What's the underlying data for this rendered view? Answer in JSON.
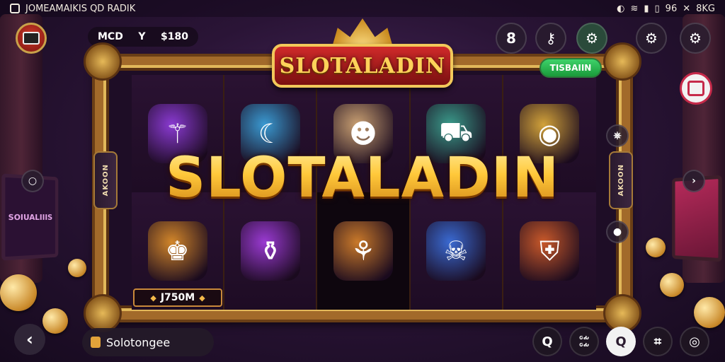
{
  "status_bar": {
    "left_text": "JOMEAMAIKIS QD RADIK",
    "right_text": "96",
    "right_text2": "8KG",
    "icons": [
      "app-icon",
      "circle-icon",
      "wifi-icon",
      "signal-icon",
      "battery-icon",
      "close-x-icon"
    ]
  },
  "top_left": {
    "pill_left": "MCD",
    "pill_mid": "Y",
    "pill_right": "$180"
  },
  "banner": {
    "title": "SLOTALADIN"
  },
  "logo": {
    "text": "SLOTALADIN"
  },
  "side_tabs": {
    "left": "AKOON",
    "right": "AKOON"
  },
  "green_badge": "TISBAIIN",
  "reels": [
    {
      "icon": "staff-orb-icon",
      "glyph": "⚚",
      "color": "#8a3ad2"
    },
    {
      "icon": "wave-icon",
      "glyph": "☾",
      "color": "#3a9ad2"
    },
    {
      "icon": "genie-mask-icon",
      "glyph": "☻",
      "color": "#c9a072"
    },
    {
      "icon": "cart-icon",
      "glyph": "⛟",
      "color": "#3a9a8a"
    },
    {
      "icon": "golden-ring-icon",
      "glyph": "◉",
      "color": "#d2a23a"
    },
    {
      "icon": "golden-idol-icon",
      "glyph": "♚",
      "color": "#d2862a"
    },
    {
      "icon": "purple-lamp-icon",
      "glyph": "⚱",
      "color": "#9a3ad2"
    },
    {
      "icon": "sitar-bowl-icon",
      "glyph": "⚘",
      "color": "#c9792a"
    },
    {
      "icon": "blue-demon-icon",
      "glyph": "☠",
      "color": "#3a6ad2"
    },
    {
      "icon": "shield-ribbon-icon",
      "glyph": "⛨",
      "color": "#c9592a"
    }
  ],
  "win_box": {
    "label": "J750M"
  },
  "controls": {
    "btn1": "8",
    "btn2": "⚷",
    "btn3": "⚙",
    "btn4": "⚙",
    "btn5": "⚙",
    "mini1": "⎈",
    "mini2": "●",
    "left_mini": "○",
    "right_arrow": "›"
  },
  "bottom_bar": {
    "back": "‹",
    "pill_text": "Solotongee",
    "btn_search": "Q",
    "btn_grid_line1": "ԍԃ",
    "btn_grid_line2": "ԍԃ",
    "btn_q": "Q",
    "btn_crop": "⌗",
    "btn_target": "◎"
  },
  "colors": {
    "gold": "#ffc83a",
    "frame": "#a26a2a",
    "banner_red": "#d02a2a",
    "badge_green": "#3ed26a",
    "stop_red": "#c62a4a"
  }
}
